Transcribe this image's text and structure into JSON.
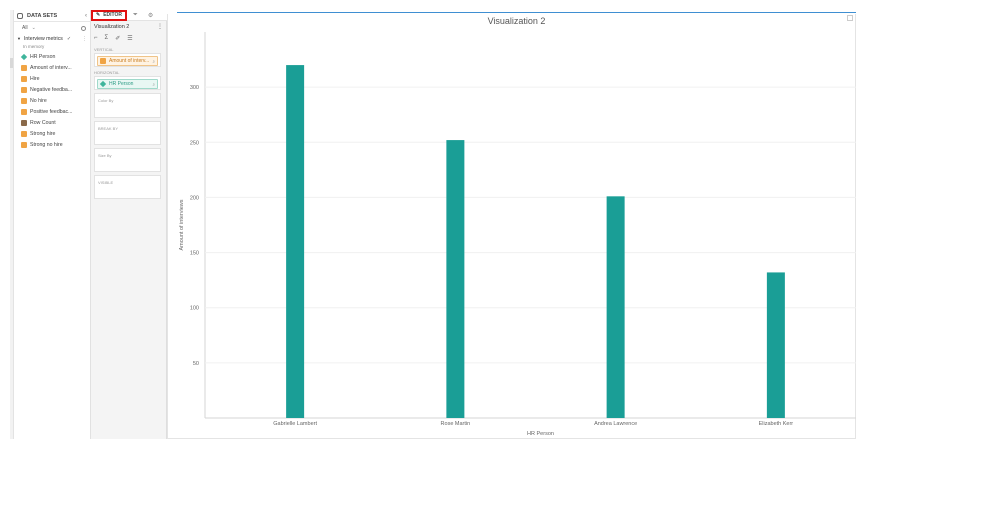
{
  "data_panel": {
    "title": "DATA SETS",
    "filter_value": "All",
    "dataset_name": "Interview metrics",
    "dataset_source": "In memory",
    "fields": [
      {
        "label": "HR Person",
        "kind": "dim"
      },
      {
        "label": "Amount of interv...",
        "kind": "measure"
      },
      {
        "label": "Hire",
        "kind": "measure"
      },
      {
        "label": "Negative feedba...",
        "kind": "measure"
      },
      {
        "label": "No hire",
        "kind": "measure"
      },
      {
        "label": "Positive feedbac...",
        "kind": "measure"
      },
      {
        "label": "Row Count",
        "kind": "count"
      },
      {
        "label": "Strong hire",
        "kind": "measure"
      },
      {
        "label": "Strong no hire",
        "kind": "measure"
      }
    ]
  },
  "editor": {
    "tab_label": "EDITOR",
    "viz_name": "Visualization 2",
    "shelves": {
      "vertical": {
        "label": "VERTICAL",
        "pill": "Amount of interv..."
      },
      "horizontal": {
        "label": "HORIZONTAL",
        "pill": "HR Person"
      },
      "color_by": "Color By",
      "break_by": "BREAK BY",
      "size_by": "Size By",
      "visible": "VISIBLE"
    }
  },
  "chart_data": {
    "type": "bar",
    "title": "Visualization 2",
    "xlabel": "HR Person",
    "ylabel": "Amount of interviews",
    "categories": [
      "Gabrielle Lambert",
      "Rose Martin",
      "Andrea Lawrence",
      "Elizabeth Kerr"
    ],
    "values": [
      320,
      252,
      201,
      132
    ],
    "yticks": [
      50,
      100,
      150,
      200,
      250,
      300
    ],
    "ylim": [
      0,
      350
    ],
    "bar_color": "#1a9e96",
    "grid": true
  }
}
